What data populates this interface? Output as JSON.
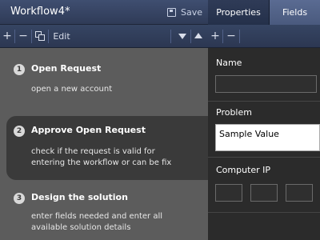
{
  "app": {
    "title": "Workflow4*",
    "save_label": "Save"
  },
  "toolbar": {
    "add": "+",
    "remove": "−",
    "edit_label": "Edit"
  },
  "tabs": [
    {
      "label": "Properties",
      "active": false
    },
    {
      "label": "Fields",
      "active": true
    }
  ],
  "steps": [
    {
      "number": "1",
      "title": "Open Request",
      "description": "open a new account"
    },
    {
      "number": "2",
      "title": "Approve Open Request",
      "description": "check if the request is valid for entering the workflow or can be fix"
    },
    {
      "number": "3",
      "title": "Design the solution",
      "description": "enter fields needed and enter all available solution details"
    }
  ],
  "fields": [
    {
      "label": "Name",
      "value": ""
    },
    {
      "label": "Problem",
      "value": "Sample Value"
    },
    {
      "label": "Computer IP",
      "value": ""
    }
  ],
  "colors": {
    "accent": "#4a5a7e",
    "panel": "#5c5c5c",
    "selected_step": "#3a3a3a"
  }
}
